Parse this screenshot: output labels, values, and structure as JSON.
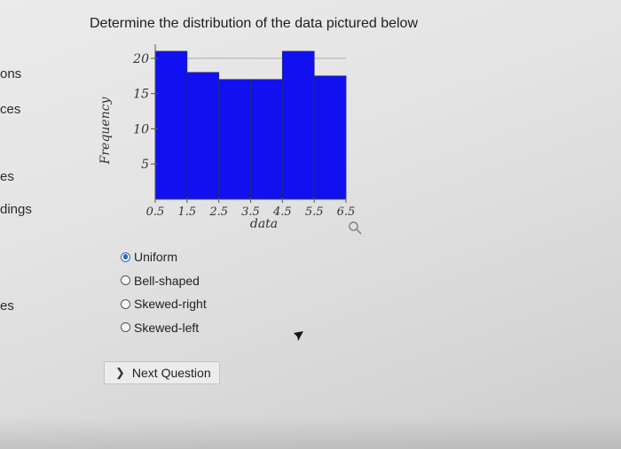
{
  "sidebar": {
    "items": [
      {
        "label": "ons"
      },
      {
        "label": "ces"
      },
      {
        "label": "es"
      },
      {
        "label": "dings"
      },
      {
        "label": "es"
      }
    ]
  },
  "question": {
    "title": "Determine the distribution of the data pictured below"
  },
  "chart_data": {
    "type": "bar",
    "categories": [
      "0.5-1.5",
      "1.5-2.5",
      "2.5-3.5",
      "3.5-4.5",
      "4.5-5.5",
      "5.5-6.5"
    ],
    "bin_edges": [
      0.5,
      1.5,
      2.5,
      3.5,
      4.5,
      5.5,
      6.5
    ],
    "values": [
      21,
      18,
      17,
      17,
      21,
      17.5
    ],
    "xlabel": "data",
    "ylabel": "Frequency",
    "xlim": [
      0.5,
      6.5
    ],
    "ylim": [
      0,
      22
    ],
    "yticks": [
      5,
      10,
      15,
      20
    ],
    "xticks": [
      "0.5",
      "1.5",
      "2.5",
      "3.5",
      "4.5",
      "5.5",
      "6.5"
    ],
    "grid": true,
    "colors": {
      "bar_fill": "#1010f0",
      "bar_stroke": "#2a2a7a"
    }
  },
  "answers": {
    "options": [
      {
        "label": "Uniform",
        "selected": true
      },
      {
        "label": "Bell-shaped",
        "selected": false
      },
      {
        "label": "Skewed-right",
        "selected": false
      },
      {
        "label": "Skewed-left",
        "selected": false
      }
    ]
  },
  "navigation": {
    "next_label": "Next Question",
    "next_icon": "chevron-right-icon",
    "zoom_icon": "magnifier-icon"
  },
  "colors": {
    "accent": "#2a65c9"
  }
}
